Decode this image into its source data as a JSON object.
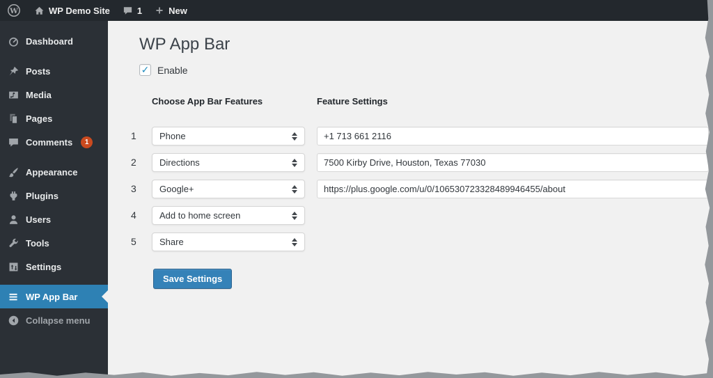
{
  "admin_bar": {
    "site_name": "WP Demo Site",
    "comment_count": "1",
    "new_label": "New"
  },
  "sidebar": {
    "items": [
      {
        "label": "Dashboard",
        "icon": "dashboard-icon"
      },
      {
        "label": "Posts",
        "icon": "posts-icon"
      },
      {
        "label": "Media",
        "icon": "media-icon"
      },
      {
        "label": "Pages",
        "icon": "pages-icon"
      },
      {
        "label": "Comments",
        "icon": "comments-icon",
        "badge": "1"
      },
      {
        "label": "Appearance",
        "icon": "appearance-icon"
      },
      {
        "label": "Plugins",
        "icon": "plugins-icon"
      },
      {
        "label": "Users",
        "icon": "users-icon"
      },
      {
        "label": "Tools",
        "icon": "tools-icon"
      },
      {
        "label": "Settings",
        "icon": "settings-icon"
      },
      {
        "label": "WP App Bar",
        "icon": "wp-app-bar-icon",
        "active": true
      },
      {
        "label": "Collapse menu",
        "icon": "collapse-icon"
      }
    ]
  },
  "main": {
    "title": "WP App Bar",
    "enable_label": "Enable",
    "enable_checked": true,
    "col_features": "Choose App Bar Features",
    "col_settings": "Feature Settings",
    "rows": [
      {
        "num": "1",
        "feature": "Phone",
        "setting": "+1 713 661 2116"
      },
      {
        "num": "2",
        "feature": "Directions",
        "setting": "7500 Kirby Drive, Houston, Texas 77030"
      },
      {
        "num": "3",
        "feature": "Google+",
        "setting": "https://plus.google.com/u/0/106530723328489946455/about"
      },
      {
        "num": "4",
        "feature": "Add to home screen",
        "setting": ""
      },
      {
        "num": "5",
        "feature": "Share",
        "setting": ""
      }
    ],
    "save_label": "Save Settings"
  },
  "colors": {
    "admin_bar_bg": "#23282d",
    "sidebar_bg": "#2b3036",
    "content_bg": "#f1f1f1",
    "active_item_bg": "#2e81b4",
    "button_bg": "#3582b8",
    "badge_bg": "#ca4a1f",
    "check_blue": "#1e8cbe"
  }
}
